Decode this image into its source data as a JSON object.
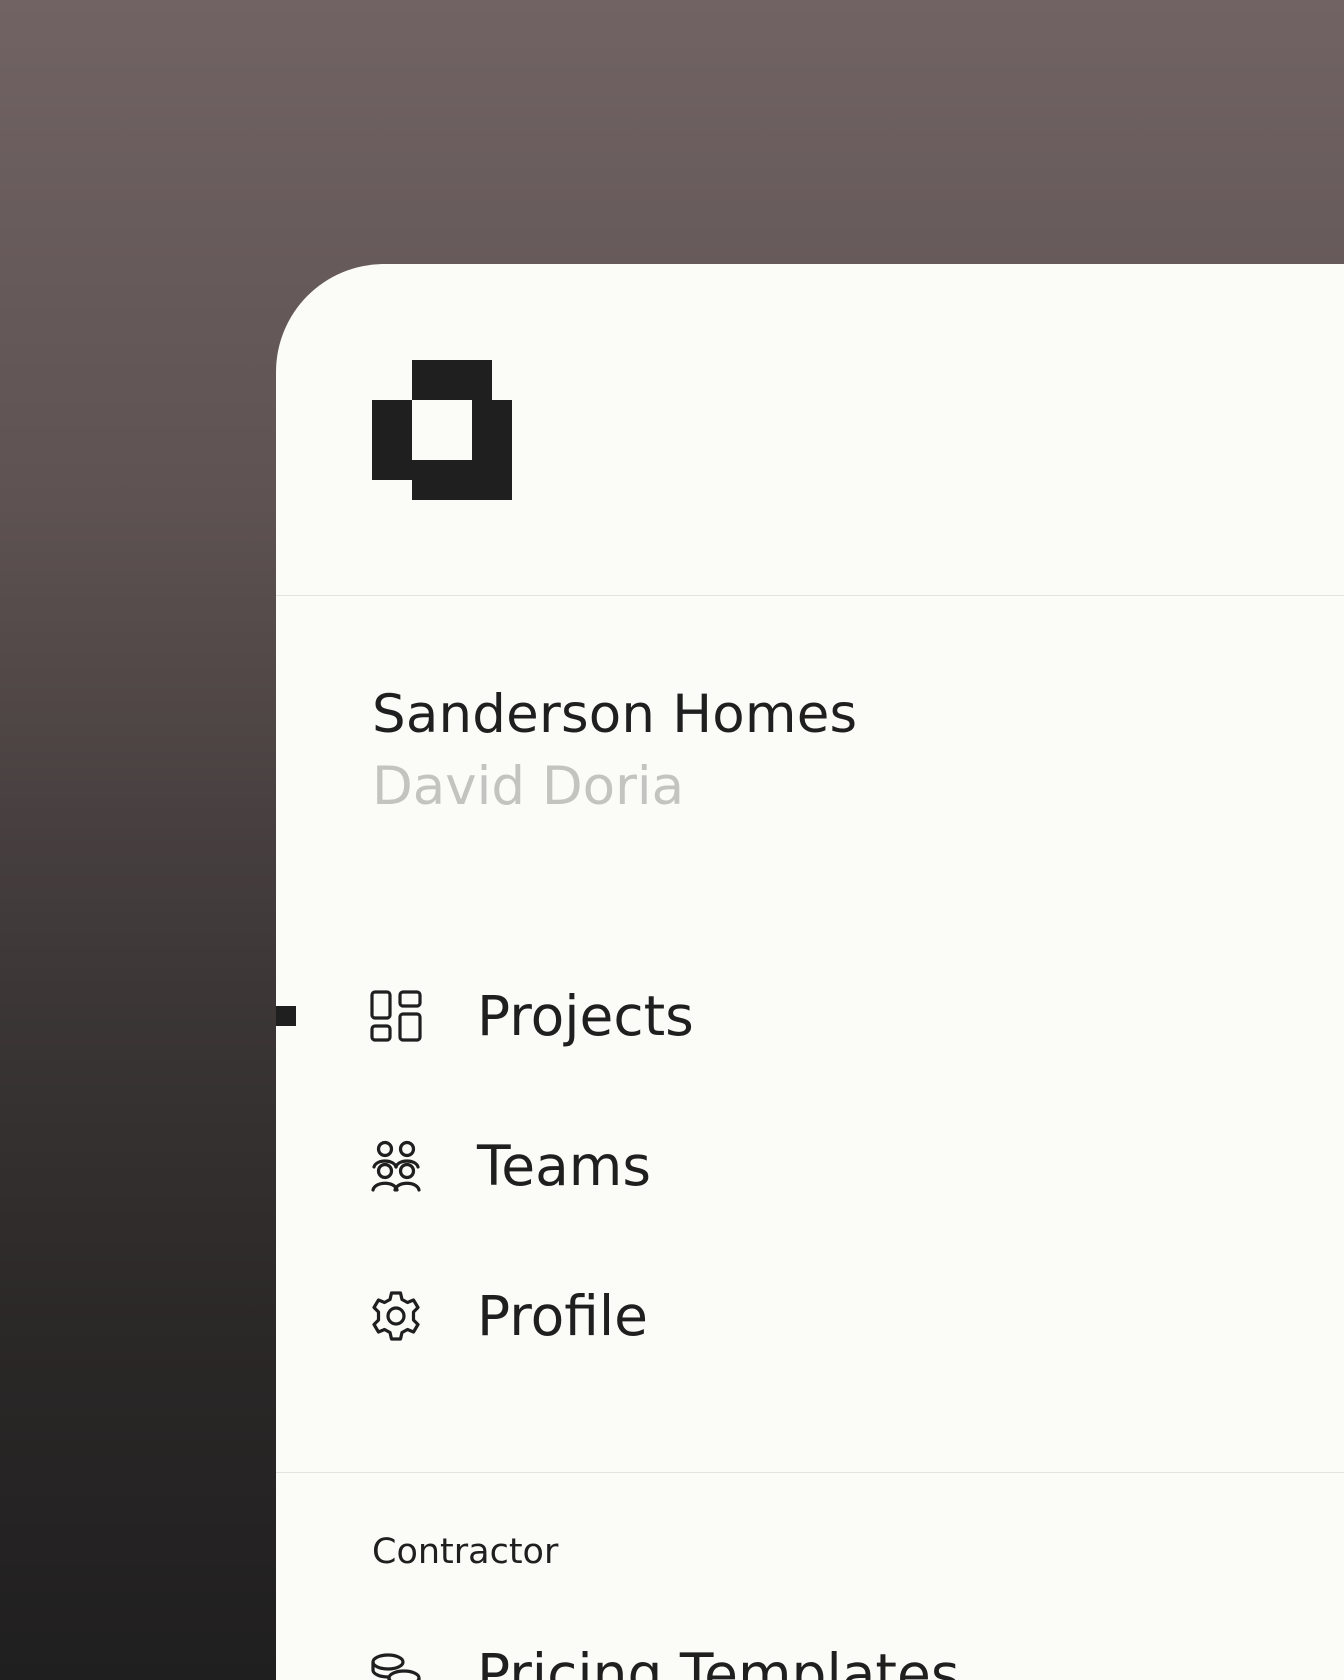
{
  "organization": {
    "name": "Sanderson Homes",
    "user": "David Doria"
  },
  "nav": {
    "items": [
      {
        "label": "Projects",
        "icon": "dashboard-grid-icon",
        "active": true
      },
      {
        "label": "Teams",
        "icon": "users-group-icon",
        "active": false
      },
      {
        "label": "Profile",
        "icon": "gear-icon",
        "active": false
      }
    ]
  },
  "contractor": {
    "section_label": "Contractor",
    "items": [
      {
        "label": "Pricing Templates",
        "icon": "coins-stack-icon"
      }
    ]
  },
  "colors": {
    "panel_bg": "#fbfbf8",
    "text_primary": "#1f1f1f",
    "text_muted": "#c3c3c0",
    "divider": "#e3e3df"
  }
}
